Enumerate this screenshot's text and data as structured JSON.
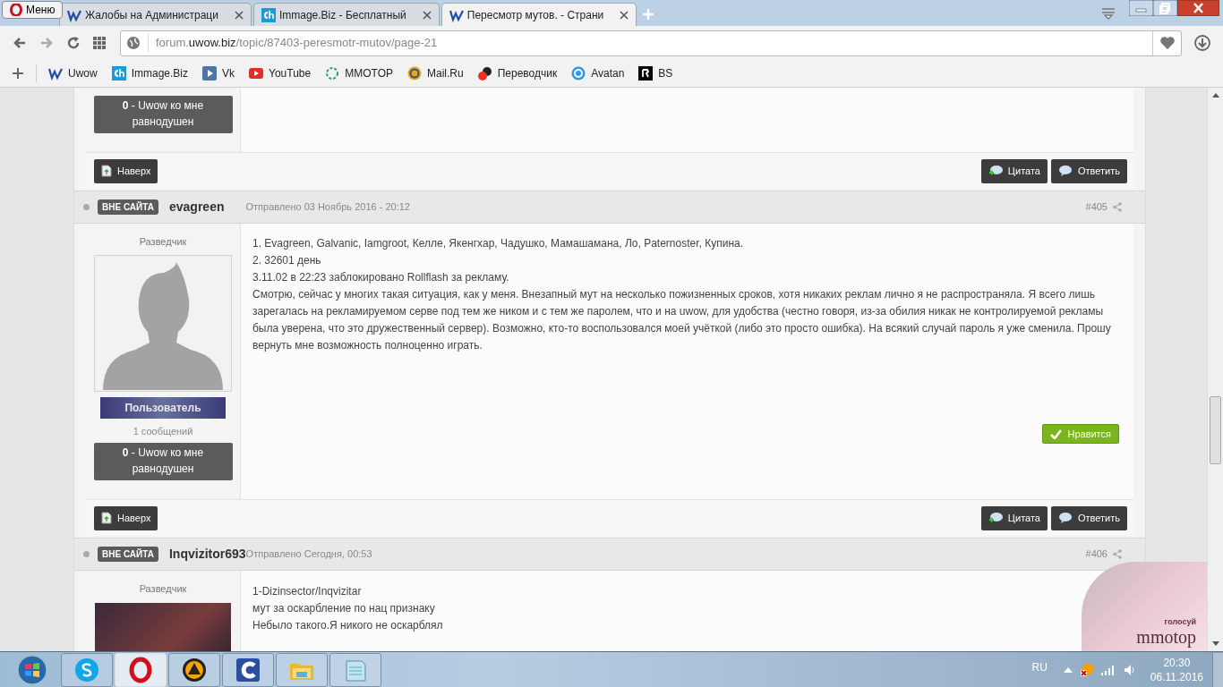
{
  "browser": {
    "menu_label": "Меню",
    "tabs": [
      {
        "title": "Жалобы на Администраци",
        "selected": false
      },
      {
        "title": "Immage.Biz - Бесплатный",
        "selected": false
      },
      {
        "title": "Пересмотр мутов. - Страни",
        "selected": true
      }
    ],
    "url": {
      "prefix": "forum.",
      "host": "uwow.biz",
      "path": "/topic/87403-peresmotr-mutov/page-21"
    },
    "bookmarks": [
      "Uwow",
      "Immage.Biz",
      "Vk",
      "YouTube",
      "MMOTOP",
      "Mail.Ru",
      "Переводчик",
      "Avatan",
      "BS"
    ]
  },
  "posts": [
    {
      "kind": "partial",
      "reputation": "**0** - Uwow ко мне равнодушен",
      "footer": {
        "top": "Наверх",
        "quote": "Цитата",
        "reply": "Ответить"
      }
    },
    {
      "kind": "full",
      "status": "ВНЕ САЙТА",
      "author": "evagreen",
      "date": "Отправлено 03 Ноябрь 2016 - 20:12",
      "number": "#405",
      "rank": "Разведчик",
      "group": "Пользователь",
      "post_count": "1 сообщений",
      "reputation": "**0** - Uwow ко мне равнодушен",
      "body": [
        "1. Evagreen, Galvanic, Iamgroot, Келле, Якенгхар, Чадушко, Мамашамана, Ло, Paternoster, Купина.",
        "2. 32601 день",
        "3.11.02 в 22:23 заблокировано Rollflash за рекламу.",
        "Смотрю, сейчас у многих такая ситуация, как у меня. Внезапный мут на несколько пожизненных сроков, хотя никаких реклам лично я не распространяла. Я всего лишь зарегалась на рекламируемом серве под тем же ником и с тем же паролем, что и на uwow, для удобства (честно говоря, из-за обилия никак не контролируемой рекламы была уверена, что это дружественный сервер). Возможно, кто-то воспользовался моей учёткой (либо это просто ошибка). На всякий случай пароль я уже сменила. Прошу вернуть мне возможность полноценно играть."
      ],
      "like": "Нравится",
      "footer": {
        "top": "Наверх",
        "quote": "Цитата",
        "reply": "Ответить"
      }
    },
    {
      "kind": "cut",
      "status": "ВНЕ САЙТА",
      "author": "Inqvizitor693",
      "date": "Отправлено Сегодня, 00:53",
      "number": "#406",
      "rank": "Разведчик",
      "body": [
        "1-Dizinsector/Inqvizitar",
        "мут за оскарбление по нац признаку",
        "Небыло такого.Я никого не оскарблял"
      ]
    }
  ],
  "ad": {
    "caption": "голосуй",
    "logo": "mmotop"
  },
  "taskbar": {
    "apps": [
      {
        "selected": false
      },
      {
        "selected": true
      },
      {
        "selected": false
      },
      {
        "selected": false
      },
      {
        "selected": false
      },
      {
        "selected": false
      }
    ],
    "language": "RU",
    "time": "20:30",
    "date": "06.11.2016"
  }
}
